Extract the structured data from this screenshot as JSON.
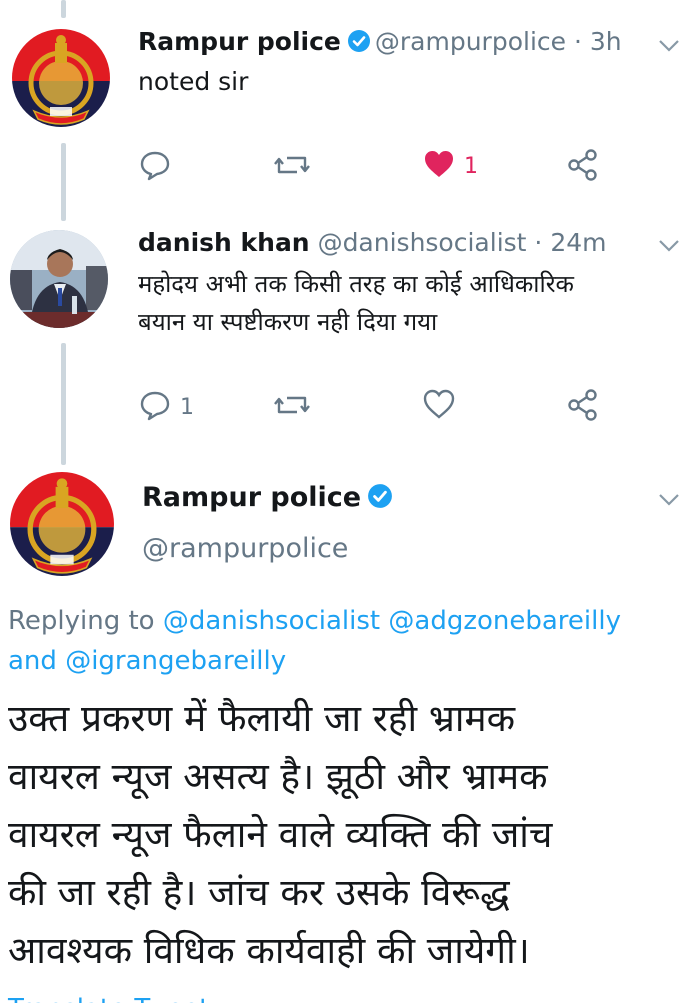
{
  "colors": {
    "accent": "#1da1f2",
    "like": "#e0245e",
    "secondary_text": "#657786",
    "thread_line": "#ccd6dd"
  },
  "tweets": [
    {
      "name": "Rampur police",
      "verified": true,
      "handle": "@rampurpolice",
      "time": "· 3h",
      "text_lines": [
        "noted sir"
      ],
      "avatar": "up-police-emblem",
      "actions": {
        "reply_count": "",
        "retweet_count": "",
        "like_count": "1",
        "liked": true
      }
    },
    {
      "name": "danish khan",
      "verified": false,
      "handle": "@danishsocialist",
      "time": "· 24m",
      "text_lines": [
        "महोदय अभी तक किसी तरह का कोई आधिकारिक",
        "बयान या स्पष्टीकरण नही दिया गया"
      ],
      "avatar": "person-photo",
      "actions": {
        "reply_count": "1",
        "retweet_count": "",
        "like_count": "",
        "liked": false
      }
    }
  ],
  "main_tweet": {
    "name": "Rampur police",
    "verified": true,
    "handle": "@rampurpolice",
    "replying_prefix": "Replying to",
    "reply_to_1": "@danishsocialist",
    "reply_to_2": "@adgzonebareilly",
    "reply_to_and": "and",
    "reply_to_3": "@igrangebareilly",
    "text_lines": [
      "उक्त प्रकरण में फैलायी जा रही भ्रामक",
      "वायरल न्यूज असत्य है। झूठी और भ्रामक",
      "वायरल न्यूज फैलाने वाले व्यक्ति की जांच",
      "की जा रही है। जांच कर उसके विरूद्ध",
      "आवश्यक विधिक कार्यवाही की जायेगी।"
    ],
    "translate_label": "Translate Tweet"
  },
  "icons": {
    "reply": "reply-icon",
    "retweet": "retweet-icon",
    "like": "heart-icon",
    "share": "share-icon",
    "caret": "chevron-down-icon",
    "verified": "verified-badge-icon"
  }
}
